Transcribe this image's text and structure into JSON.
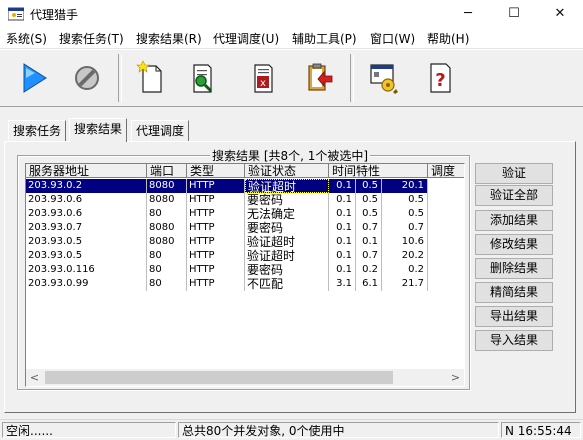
{
  "window": {
    "title": "代理猎手",
    "minimize": "─",
    "maximize": "☐",
    "close": "✕"
  },
  "menu": [
    "系统(S)",
    "搜索任务(T)",
    "搜索结果(R)",
    "代理调度(U)",
    "辅助工具(P)",
    "窗口(W)",
    "帮助(H)"
  ],
  "toolbar": {
    "icons": [
      "play-icon",
      "stop-icon",
      "new-document-icon",
      "search-document-icon",
      "report-document-icon",
      "import-clipboard-icon",
      "settings-icon",
      "help-icon"
    ],
    "help_glyph": "?"
  },
  "tabs": [
    "搜索任务",
    "搜索结果",
    "代理调度"
  ],
  "active_tab": 1,
  "results": {
    "group_title": "搜索结果 [共8个, 1个被选中]",
    "columns": [
      "服务器地址",
      "端口",
      "类型",
      "验证状态",
      "时间特性",
      "调度"
    ],
    "rows": [
      {
        "addr": "203.93.0.2",
        "port": "8080",
        "type": "HTTP",
        "status": "验证超时",
        "t1": "0.1",
        "t2": "0.5",
        "t3": "20.1",
        "selected": true
      },
      {
        "addr": "203.93.0.6",
        "port": "8080",
        "type": "HTTP",
        "status": "要密码",
        "t1": "0.1",
        "t2": "0.5",
        "t3": "0.5"
      },
      {
        "addr": "203.93.0.6",
        "port": "80",
        "type": "HTTP",
        "status": "无法确定",
        "t1": "0.1",
        "t2": "0.5",
        "t3": "0.5"
      },
      {
        "addr": "203.93.0.7",
        "port": "8080",
        "type": "HTTP",
        "status": "要密码",
        "t1": "0.1",
        "t2": "0.7",
        "t3": "0.7"
      },
      {
        "addr": "203.93.0.5",
        "port": "8080",
        "type": "HTTP",
        "status": "验证超时",
        "t1": "0.1",
        "t2": "0.1",
        "t3": "10.6"
      },
      {
        "addr": "203.93.0.5",
        "port": "80",
        "type": "HTTP",
        "status": "验证超时",
        "t1": "0.1",
        "t2": "0.7",
        "t3": "20.2"
      },
      {
        "addr": "203.93.0.116",
        "port": "80",
        "type": "HTTP",
        "status": "要密码",
        "t1": "0.1",
        "t2": "0.2",
        "t3": "0.2"
      },
      {
        "addr": "203.93.0.99",
        "port": "80",
        "type": "HTTP",
        "status": "不匹配",
        "t1": "3.1",
        "t2": "6.1",
        "t3": "21.7"
      }
    ],
    "scroll_left": "<",
    "scroll_right": ">"
  },
  "buttons": [
    "验证",
    "验证全部",
    "添加结果",
    "修改结果",
    "删除结果",
    "精简结果",
    "导出结果",
    "导入结果"
  ],
  "status": {
    "left": "空闲......",
    "middle": "总共80个并发对象, 0个使用中",
    "right": "N 16:55:44"
  },
  "colors": {
    "selection": "#000080",
    "focus_outline": "#ffff00",
    "play": "#1e90ff"
  }
}
